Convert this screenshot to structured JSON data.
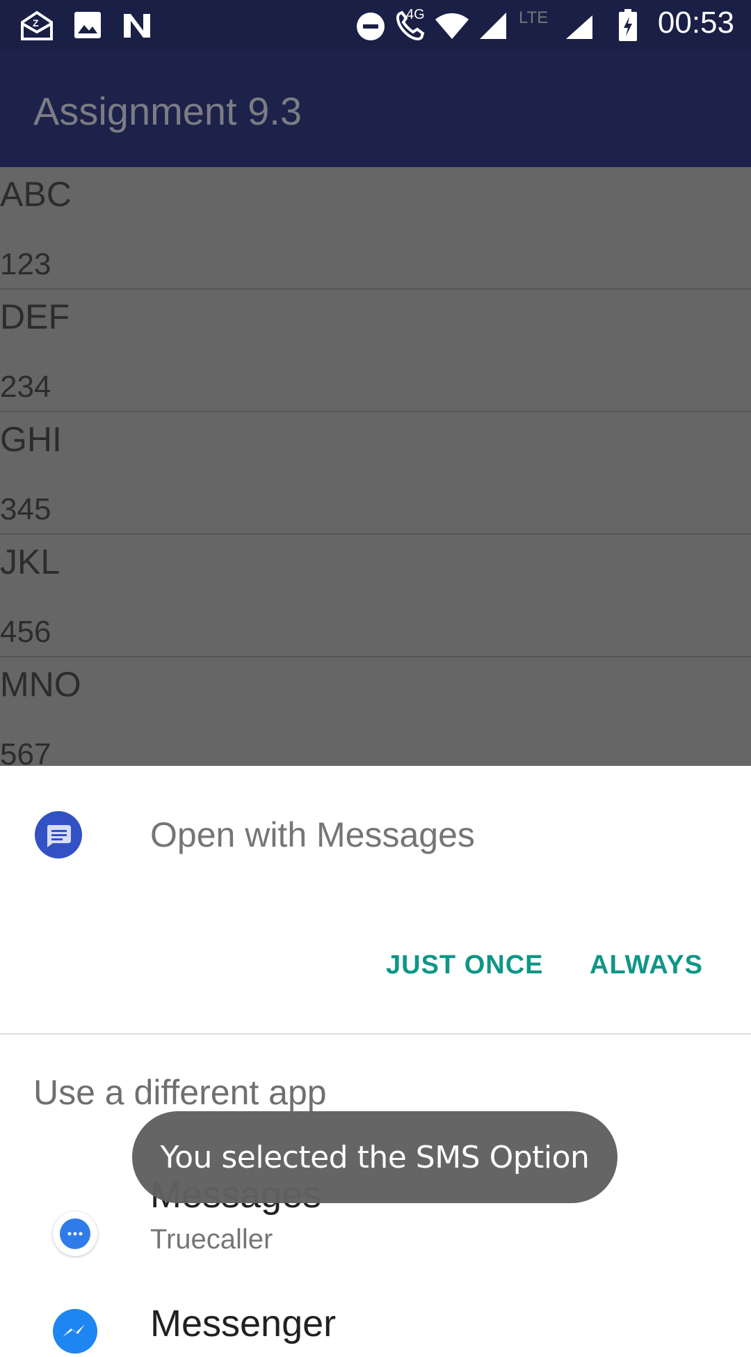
{
  "status_bar": {
    "time": "00:53",
    "network_label_1": "4G",
    "network_label_2": "LTE",
    "icons": [
      "mail-icon",
      "image-icon",
      "n-icon",
      "do-not-disturb-icon",
      "wifi-call-icon",
      "wifi-icon",
      "signal-icon",
      "signal-icon-2",
      "battery-icon"
    ]
  },
  "app_bar": {
    "title": "Assignment 9.3"
  },
  "list": {
    "items": [
      {
        "name": "ABC",
        "number": "123"
      },
      {
        "name": "DEF",
        "number": "234"
      },
      {
        "name": "GHI",
        "number": "345"
      },
      {
        "name": "JKL",
        "number": "456"
      },
      {
        "name": "MNO",
        "number": "567"
      }
    ]
  },
  "sheet": {
    "title": "Open with Messages",
    "just_once": "JUST ONCE",
    "always": "ALWAYS",
    "section_label": "Use a different app",
    "apps": [
      {
        "label": "Messages",
        "sublabel": "Truecaller"
      },
      {
        "label": "Messenger"
      }
    ]
  },
  "toast": {
    "text": "You selected the SMS Option"
  },
  "colors": {
    "status_bar": "#1a1f45",
    "app_bar": "#1c2249",
    "accent": "#0f9688",
    "scrim": "#666666",
    "toast": "#606060"
  }
}
